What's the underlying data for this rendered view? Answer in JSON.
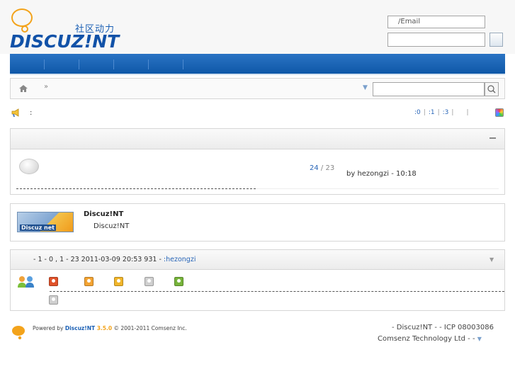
{
  "header": {
    "logo_cn": "社区动力",
    "logo_word": "DISCUZ!NT",
    "login_user_placeholder": "/Email"
  },
  "breadcrumb": {
    "separator": "»"
  },
  "announcement": {
    "colon": ":"
  },
  "stats": {
    "a": ":0",
    "b": ":1",
    "c": ":3"
  },
  "forum": {
    "topics": "24",
    "posts": "/ 23",
    "last_post": "by hezongzi -    10:18"
  },
  "links": {
    "title": "Discuz!NT",
    "desc": "Discuz!NT",
    "logo_label": "Discuz net"
  },
  "online": {
    "summary": "- 1   - 0  , 1   -      23   2011-03-09 20:53     931   -",
    "user": ":hezongzi",
    "toggle": "▼",
    "legend_colors": [
      "#e0522a",
      "#f3a332",
      "#f0b52a",
      "#cfcfcf",
      "#76b33a",
      "#cfcfcf"
    ]
  },
  "footer": {
    "powered_prefix": "Powered by ",
    "powered_brand": "Discuz!NT",
    "powered_version": " 3.5.0",
    "powered_suffix": " © 2001-2011 Comsenz Inc.",
    "right_line1": "- Discuz!NT -   - ICP 08003086",
    "right_line2": "Comsenz Technology Ltd -    -",
    "right_arrow": "▼"
  }
}
